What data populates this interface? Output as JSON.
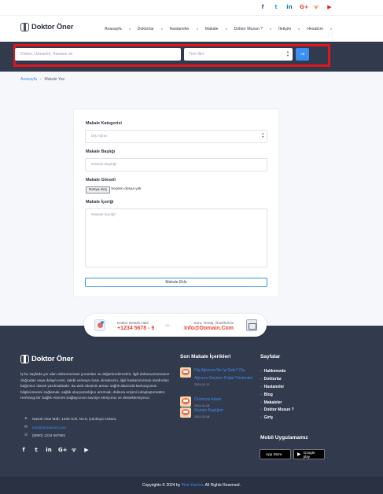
{
  "topbar": {
    "social": [
      {
        "icon": "facebook-icon",
        "glyph": "f"
      },
      {
        "icon": "twitter-icon",
        "glyph": "t"
      },
      {
        "icon": "linkedin-icon",
        "glyph": "in"
      },
      {
        "icon": "google-plus-icon",
        "glyph": "G+"
      },
      {
        "icon": "rss-icon",
        "glyph": "ᯤ"
      },
      {
        "icon": "youtube-icon",
        "glyph": "▶"
      }
    ]
  },
  "header": {
    "logo": "Doktor Öner",
    "nav": [
      "Anasayfa",
      "Doktorlar",
      "Hastaneler",
      "Makale",
      "Doktor Musun ?",
      "İletişim",
      "Hesabım"
    ]
  },
  "search": {
    "placeholder": "Doktor, Uzmanlık, Hastane vb",
    "city_selected": "Tüm İller",
    "button_icon": "arrow-right-icon"
  },
  "breadcrumb": {
    "home": "Anasayfa",
    "current": "Makale Yaz"
  },
  "form": {
    "category_label": "Makale Kategorisi",
    "category_selected": "Diş Ağrısı",
    "title_label": "Makale Başlığı",
    "title_placeholder": "Makale Başlığı*",
    "image_label": "Makale Görseli",
    "file_button": "Dosya Seç",
    "file_none": "Seçilen dosya yok",
    "content_label": "Makale İçeriği",
    "content_placeholder": "Makale İçeriği*",
    "submit": "Makale Ekle"
  },
  "contact_pill": {
    "hotline_label": "Doktor Destek Hattı",
    "hotline": "+1234 5678 - 9",
    "or": "- ve -",
    "mail_label": "Soru, Görüş, Önerileriniz",
    "mail": "Info@Domain.Com"
  },
  "footer": {
    "logo": "Doktor Öner",
    "description": "İş bu sayfada yer alan doktor/uzman yorumları ve değerlendirmeleri, ilgili doktorun/uzmanın doğrudan veya dolaylı ereri, talebi ve/veya ricası olmaksızın, ilgili hastanı/uzman tarafından bağımsız olarak yazılmaktadır. Bu web sitesinin amacı sağlık alanında kamuoyunun bilgilenmesini sağlamak, sağlık okuryazarlığını artırmak, doktora erişimi kolaylaştırmaktır. Herhangi bir Sağlık Hizmeti Sağlayıcısını tavsiye etmiyoruz ve desteklemiyoruz.",
    "address": "Nasuh Akar Mah. 1405 Sok, No:6, Çankaya Ankara",
    "email": "info@domainurl.com",
    "phone": "(0800) 1234 567891",
    "recent_heading": "Son Makale İçerikleri",
    "recent_posts": [
      {
        "title": "Diş Ağrınıza Ne İyi Gelir? Diş Ağrısını Geçiren Doğal Yöntemler",
        "date": "2024-02-13"
      },
      {
        "title": "Örümcek Adam",
        "date": "2024-02-08"
      },
      {
        "title": "Makale Başlığım",
        "date": "2024-02-08"
      }
    ],
    "pages_heading": "Sayfalar",
    "pages": [
      "Hakkımızda",
      "Doktorlar",
      "Hastaneler",
      "Blog",
      "Makaleler",
      "Doktor Musun ?",
      "Giriş"
    ],
    "mobile_heading": "Mobil Uygulamamız",
    "app_store": "App Store",
    "google_play": "Google play",
    "copyright_prefix": "Copyrights © 2024 by ",
    "copyright_link": "Pino Yazılım",
    "copyright_suffix": ". All Rights Reserved."
  }
}
